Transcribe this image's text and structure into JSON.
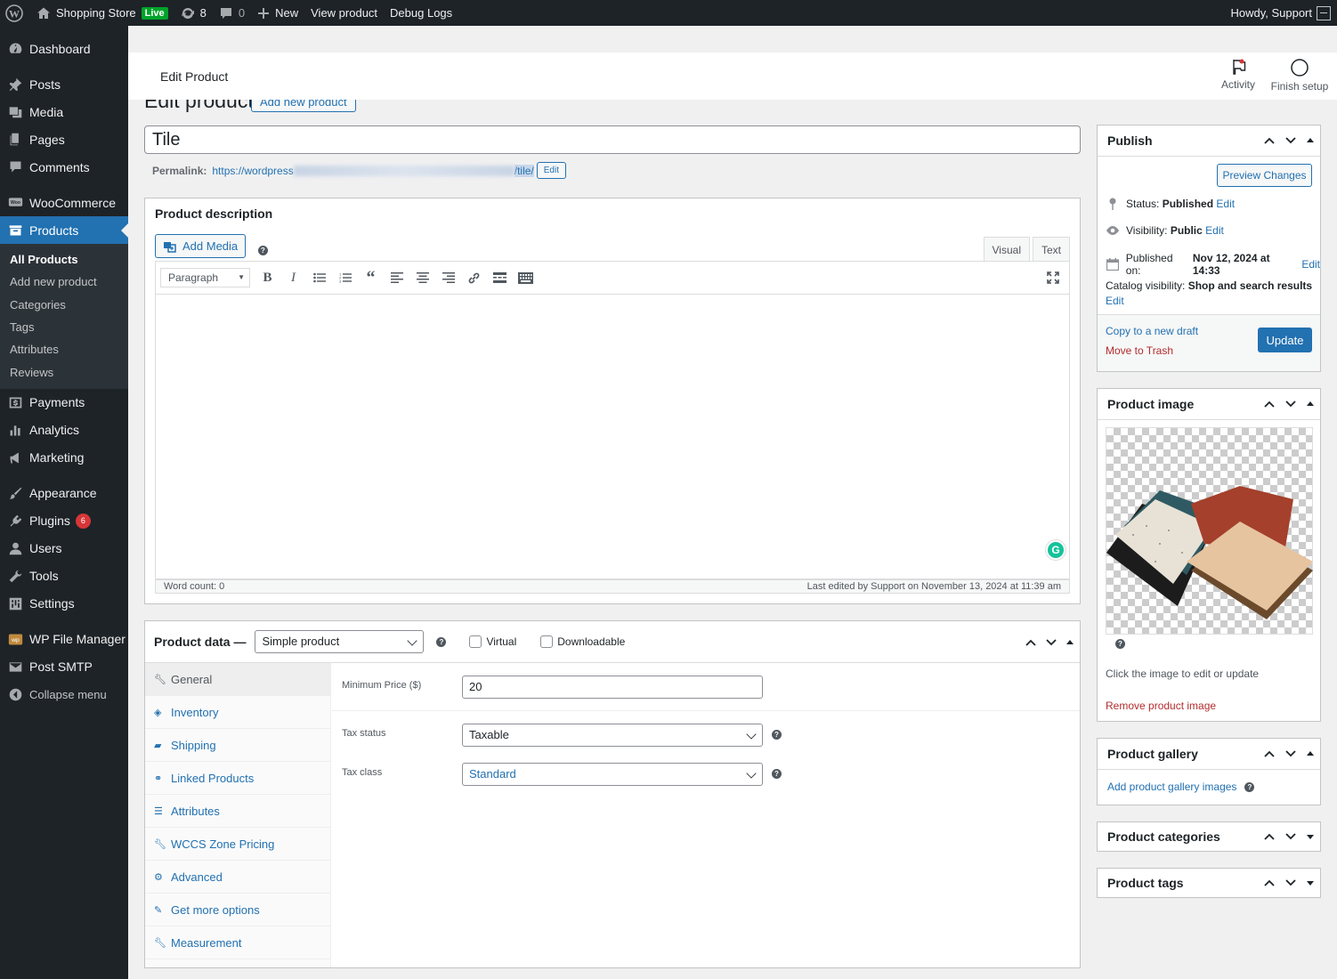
{
  "admin_bar": {
    "site_name": "Shopping Store",
    "live_badge": "Live",
    "updates_count": "8",
    "comments_count": "0",
    "new_label": "New",
    "view_product": "View product",
    "debug_logs": "Debug Logs",
    "howdy": "Howdy, Support"
  },
  "sidebar": {
    "dashboard": "Dashboard",
    "posts": "Posts",
    "media": "Media",
    "pages": "Pages",
    "comments": "Comments",
    "woocommerce": "WooCommerce",
    "products": "Products",
    "submenu": [
      "All Products",
      "Add new product",
      "Categories",
      "Tags",
      "Attributes",
      "Reviews"
    ],
    "payments": "Payments",
    "analytics": "Analytics",
    "marketing": "Marketing",
    "appearance": "Appearance",
    "plugins": "Plugins",
    "plugins_badge": "6",
    "users": "Users",
    "tools": "Tools",
    "settings": "Settings",
    "wp_file_manager": "WP File Manager",
    "post_smtp": "Post SMTP",
    "collapse": "Collapse menu"
  },
  "topbar": {
    "title": "Edit Product",
    "activity": "Activity",
    "finish_setup": "Finish setup"
  },
  "page": {
    "heading": "Edit product",
    "add_new": "Add new product",
    "product_title": "Tile",
    "permalink_label": "Permalink:",
    "permalink_start": "https://wordpress",
    "permalink_end": "/tile/",
    "permalink_edit": "Edit"
  },
  "description": {
    "title": "Product description",
    "add_media": "Add Media",
    "tab_visual": "Visual",
    "tab_text": "Text",
    "format": "Paragraph",
    "word_count": "Word count: 0",
    "last_edited": "Last edited by Support on November 13, 2024 at 11:39 am"
  },
  "product_data": {
    "title": "Product data —",
    "type": "Simple product",
    "virtual": "Virtual",
    "downloadable": "Downloadable",
    "tabs": [
      "General",
      "Inventory",
      "Shipping",
      "Linked Products",
      "Attributes",
      "WCCS Zone Pricing",
      "Advanced",
      "Get more options",
      "Measurement"
    ],
    "min_price_label": "Minimum Price ($)",
    "min_price_value": "20",
    "tax_status_label": "Tax status",
    "tax_status_value": "Taxable",
    "tax_class_label": "Tax class",
    "tax_class_value": "Standard"
  },
  "publish": {
    "title": "Publish",
    "preview": "Preview Changes",
    "status_label": "Status:",
    "status_value": "Published",
    "visibility_label": "Visibility:",
    "visibility_value": "Public",
    "published_label": "Published on:",
    "published_value": "Nov 12, 2024 at 14:33",
    "catalog_label": "Catalog visibility:",
    "catalog_value": "Shop and search results",
    "edit": "Edit",
    "copy_draft": "Copy to a new draft",
    "trash": "Move to Trash",
    "update": "Update"
  },
  "product_image": {
    "title": "Product image",
    "hint": "Click the image to edit or update",
    "remove": "Remove product image"
  },
  "gallery": {
    "title": "Product gallery",
    "add": "Add product gallery images"
  },
  "categories": {
    "title": "Product categories"
  },
  "tags": {
    "title": "Product tags"
  },
  "colors": {
    "admin_bg": "#1d2327",
    "accent": "#2271b1",
    "live": "#00a32a",
    "badge": "#d63638",
    "trash": "#b32d2e"
  }
}
